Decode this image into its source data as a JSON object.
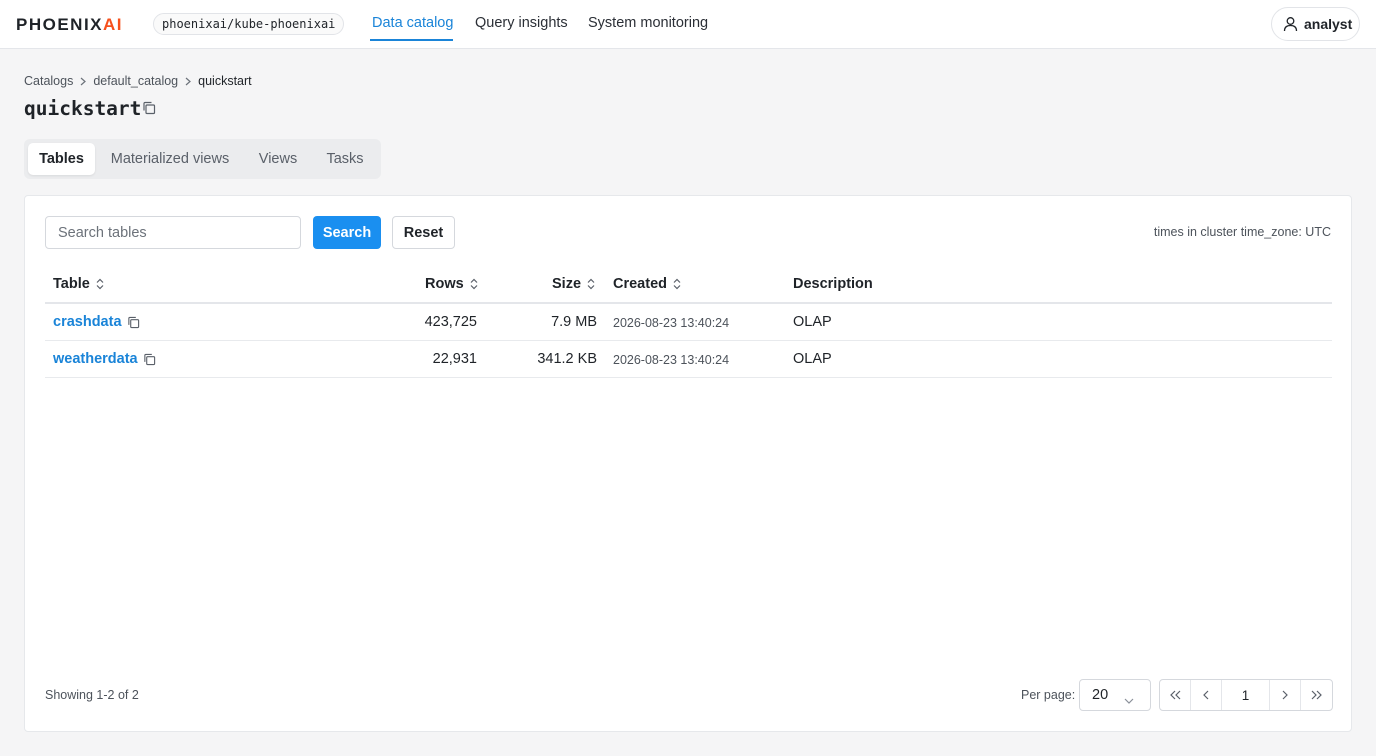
{
  "app": {
    "logo_main": "PHOENIX",
    "logo_accent": "AI",
    "cluster": "phoenixai/kube-phoenixai"
  },
  "nav": {
    "tabs": [
      {
        "label": "Data catalog",
        "active": true
      },
      {
        "label": "Query insights",
        "active": false
      },
      {
        "label": "System monitoring",
        "active": false
      }
    ],
    "user": "analyst"
  },
  "breadcrumb": [
    "Catalogs",
    "default_catalog",
    "quickstart"
  ],
  "page": {
    "title": "quickstart"
  },
  "subtabs": [
    {
      "label": "Tables",
      "active": true
    },
    {
      "label": "Materialized views",
      "active": false
    },
    {
      "label": "Views",
      "active": false
    },
    {
      "label": "Tasks",
      "active": false
    }
  ],
  "toolbar": {
    "search_placeholder": "Search tables",
    "search_value": "",
    "search_label": "Search",
    "reset_label": "Reset",
    "timezone_note": "times in cluster time_zone: UTC"
  },
  "table": {
    "columns": [
      "Table",
      "Rows",
      "Size",
      "Created",
      "Description"
    ],
    "rows": [
      {
        "name": "crashdata",
        "rows": "423,725",
        "size": "7.9 MB",
        "created": "2026-08-23 13:40:24",
        "description": "OLAP"
      },
      {
        "name": "weatherdata",
        "rows": "22,931",
        "size": "341.2 KB",
        "created": "2026-08-23 13:40:24",
        "description": "OLAP"
      }
    ]
  },
  "footer": {
    "showing": "Showing 1-2 of 2",
    "per_page_label": "Per page:",
    "per_page_value": "20",
    "current_page": "1"
  },
  "colors": {
    "accent": "#1a84d8",
    "primary_button": "#1a8ff0",
    "logo_accent": "#f6501c"
  }
}
